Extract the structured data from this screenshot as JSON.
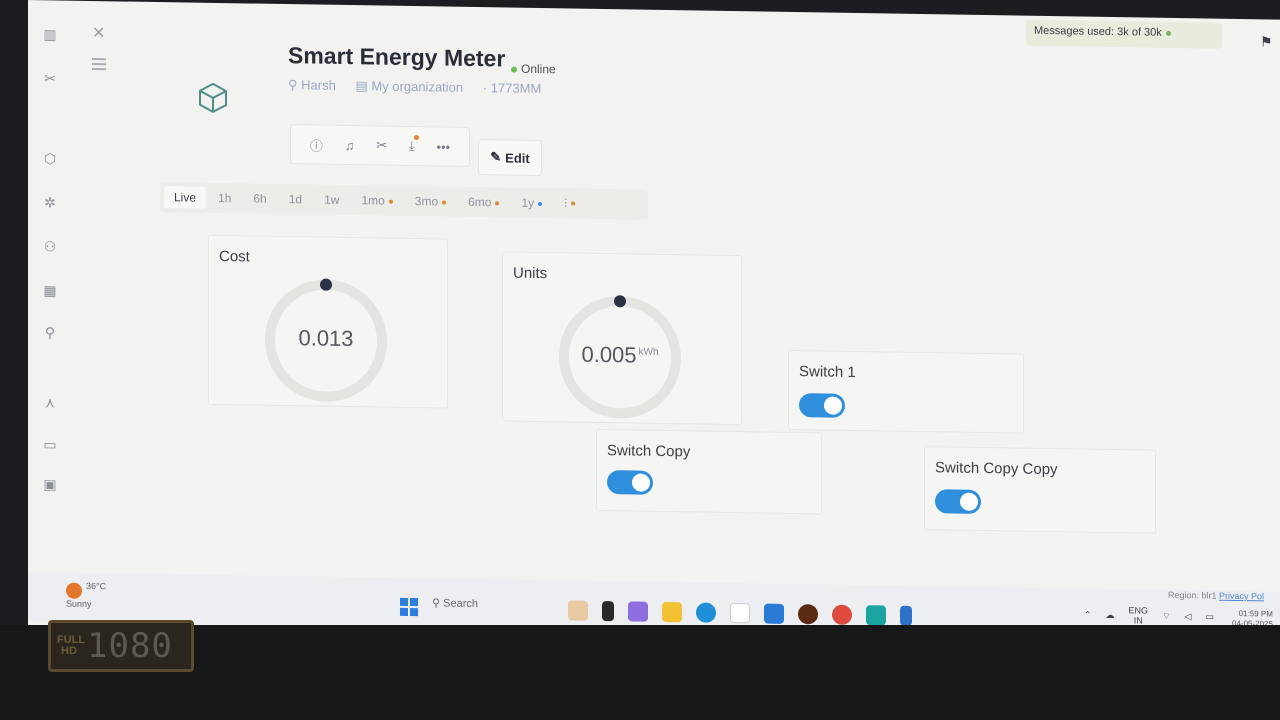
{
  "notice": {
    "text": "Messages used: 3k of 30k"
  },
  "device": {
    "title": "Smart Energy Meter",
    "status": "Online",
    "owner": "Harsh",
    "organization": "My organization",
    "code": "· 1773MM"
  },
  "toolbar": {
    "edit_label": "Edit"
  },
  "timeranges": [
    "Live",
    "1h",
    "6h",
    "1d",
    "1w",
    "1mo",
    "3mo",
    "6mo",
    "1y"
  ],
  "widgets": {
    "cost": {
      "label": "Cost",
      "value": "0.013"
    },
    "units": {
      "label": "Units",
      "value": "0.005",
      "unit": "kWh"
    },
    "switch1": {
      "label": "Switch 1",
      "on": true
    },
    "switch_copy": {
      "label": "Switch Copy",
      "on": true
    },
    "switch_copy_copy": {
      "label": "Switch Copy Copy",
      "on": true
    }
  },
  "taskbar": {
    "weather_temp": "36°C",
    "weather_desc": "Sunny",
    "search_placeholder": "Search",
    "lang_top": "ENG",
    "lang_bottom": "IN",
    "time": "01:59 PM",
    "date": "04-05-2025"
  },
  "footer": {
    "region": "Region: blr1",
    "privacy": "Privacy Pol"
  },
  "bezel": {
    "badge_small": "FULL HD",
    "badge_big": "1080"
  },
  "colors": {
    "toggle_on": "#2f8fdd",
    "online": "#6cbf53",
    "accent_dot": "#e08a2c"
  }
}
